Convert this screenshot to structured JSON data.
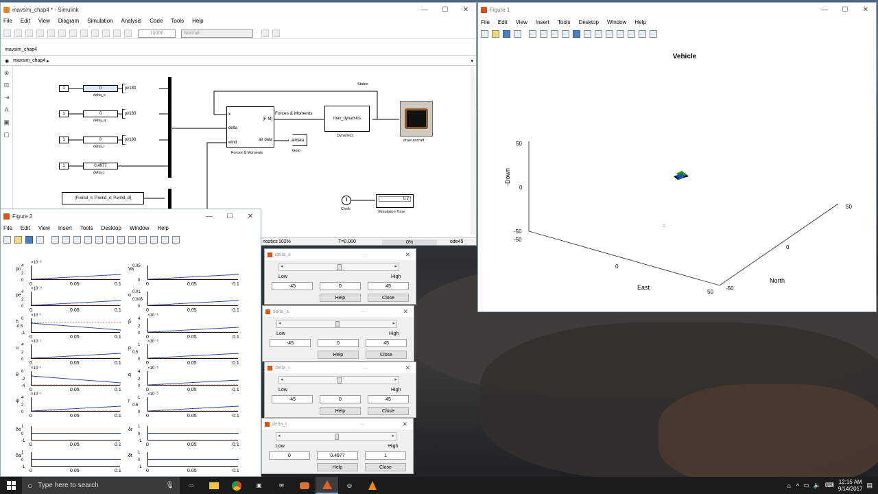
{
  "simulink": {
    "title": "mavsim_chap4 * - Simulink",
    "menu": [
      "File",
      "Edit",
      "View",
      "Diagram",
      "Simulation",
      "Analysis",
      "Code",
      "Tools",
      "Help"
    ],
    "stop_time": "10000",
    "mode": "Normal",
    "tab": "mavsim_chap4",
    "breadcrumb": "mavsim_chap4",
    "blocks": {
      "const": "1",
      "slider_e": "0",
      "slider_e_label": "delta_e",
      "slider_a": "0",
      "slider_a_label": "delta_a",
      "slider_r": "0",
      "slider_r_label": "delta_r",
      "slider_t": "0.4977",
      "slider_t_label": "delta_t",
      "gain": "pi/180",
      "wind": "[P.wind_n; P.wind_e; P.wind_d]",
      "fm_in1": "x",
      "fm_in2": "delta",
      "fm_in3": "wind",
      "fm_out1": "[F M]",
      "fm_out2": "air data",
      "fm_label": "Forces & Moments",
      "fm_signal": "Forces & Moments",
      "states": "States",
      "goto": "airdata",
      "goto_label": "Goto",
      "dyn": "mav_dynamics",
      "dyn_label": "Dynamics",
      "draw_label": "draw aircraft",
      "clock_label": "Clock",
      "display": "0.2",
      "display_label": "Simulation Time"
    },
    "status": {
      "diag": "nostics",
      "zoom": "102%",
      "time": "T=0.000",
      "progress": "0%",
      "solver": "ode45"
    }
  },
  "figure1": {
    "title": "Figure 1",
    "menu": [
      "File",
      "Edit",
      "View",
      "Insert",
      "Tools",
      "Desktop",
      "Window",
      "Help"
    ],
    "plot_title": "Vehicle",
    "zlabel": "-Down",
    "xlabel": "East",
    "ylabel": "North",
    "zticks": [
      "50",
      "0",
      "-50"
    ],
    "xticks": [
      "-50",
      "0",
      "50"
    ],
    "yticks": [
      "-50",
      "0",
      "50"
    ]
  },
  "figure2": {
    "title": "Figure 2",
    "menu": [
      "File",
      "Edit",
      "View",
      "Insert",
      "Tools",
      "Desktop",
      "Window",
      "Help"
    ],
    "xticks": [
      "0",
      "0.05",
      "0.1"
    ],
    "left_labels": [
      "pn",
      "pe",
      "h",
      "u",
      "θ",
      "ψ",
      "δe",
      "δa"
    ],
    "right_labels": [
      "Va",
      "α",
      "β",
      "p",
      "q",
      "r",
      "δr",
      "δt"
    ],
    "left_exp": [
      "×10⁻³",
      "×10⁻⁹",
      "×10⁻⁷",
      "×10⁻⁷",
      "×10⁻⁷",
      "×10⁻⁷",
      "",
      ""
    ],
    "right_exp": [
      "",
      "",
      "×10⁻⁶",
      "×10⁻⁵",
      "×10⁻⁵",
      "×10⁻⁵",
      "",
      ""
    ],
    "left_y": [
      [
        "4",
        "2",
        "0"
      ],
      [
        "4",
        "2",
        "0"
      ],
      [
        "0",
        "-0.5",
        "-1"
      ],
      [
        "4",
        "2",
        "0"
      ],
      [
        "0",
        "-2",
        "-4"
      ],
      [
        "4",
        "2",
        "0"
      ],
      [
        "1",
        "0",
        "-1"
      ],
      [
        "1",
        "0",
        "-1"
      ]
    ],
    "right_y": [
      [
        "0.05",
        "0"
      ],
      [
        "0.01",
        "0.005",
        "0"
      ],
      [
        "4",
        "2",
        "0"
      ],
      [
        "1",
        "0.5",
        "0"
      ],
      [
        "4",
        "2",
        "0"
      ],
      [
        "1",
        "0.5",
        "0"
      ],
      [
        "1",
        "0",
        "-1"
      ],
      [
        "1",
        "0",
        "-1"
      ]
    ]
  },
  "sliders": [
    {
      "title": "delta_e",
      "low": "-45",
      "value": "0",
      "high": "45",
      "low_label": "Low",
      "high_label": "High",
      "help": "Help",
      "close": "Close",
      "level": 0.5
    },
    {
      "title": "delta_a",
      "low": "-45",
      "value": "0",
      "high": "45",
      "low_label": "Low",
      "high_label": "High",
      "help": "Help",
      "close": "Close",
      "level": 0.5
    },
    {
      "title": "delta_r",
      "low": "-45",
      "value": "0",
      "high": "45",
      "low_label": "Low",
      "high_label": "High",
      "help": "Help",
      "close": "Close",
      "level": 0.5
    },
    {
      "title": "delta_t",
      "low": "0",
      "value": "0.4977",
      "high": "1",
      "low_label": "Low",
      "high_label": "High",
      "help": "Help",
      "close": "Close",
      "level": 0.4977
    }
  ],
  "taskbar": {
    "search": "Type here to search",
    "time": "12:15 AM",
    "date": "9/14/2017"
  }
}
